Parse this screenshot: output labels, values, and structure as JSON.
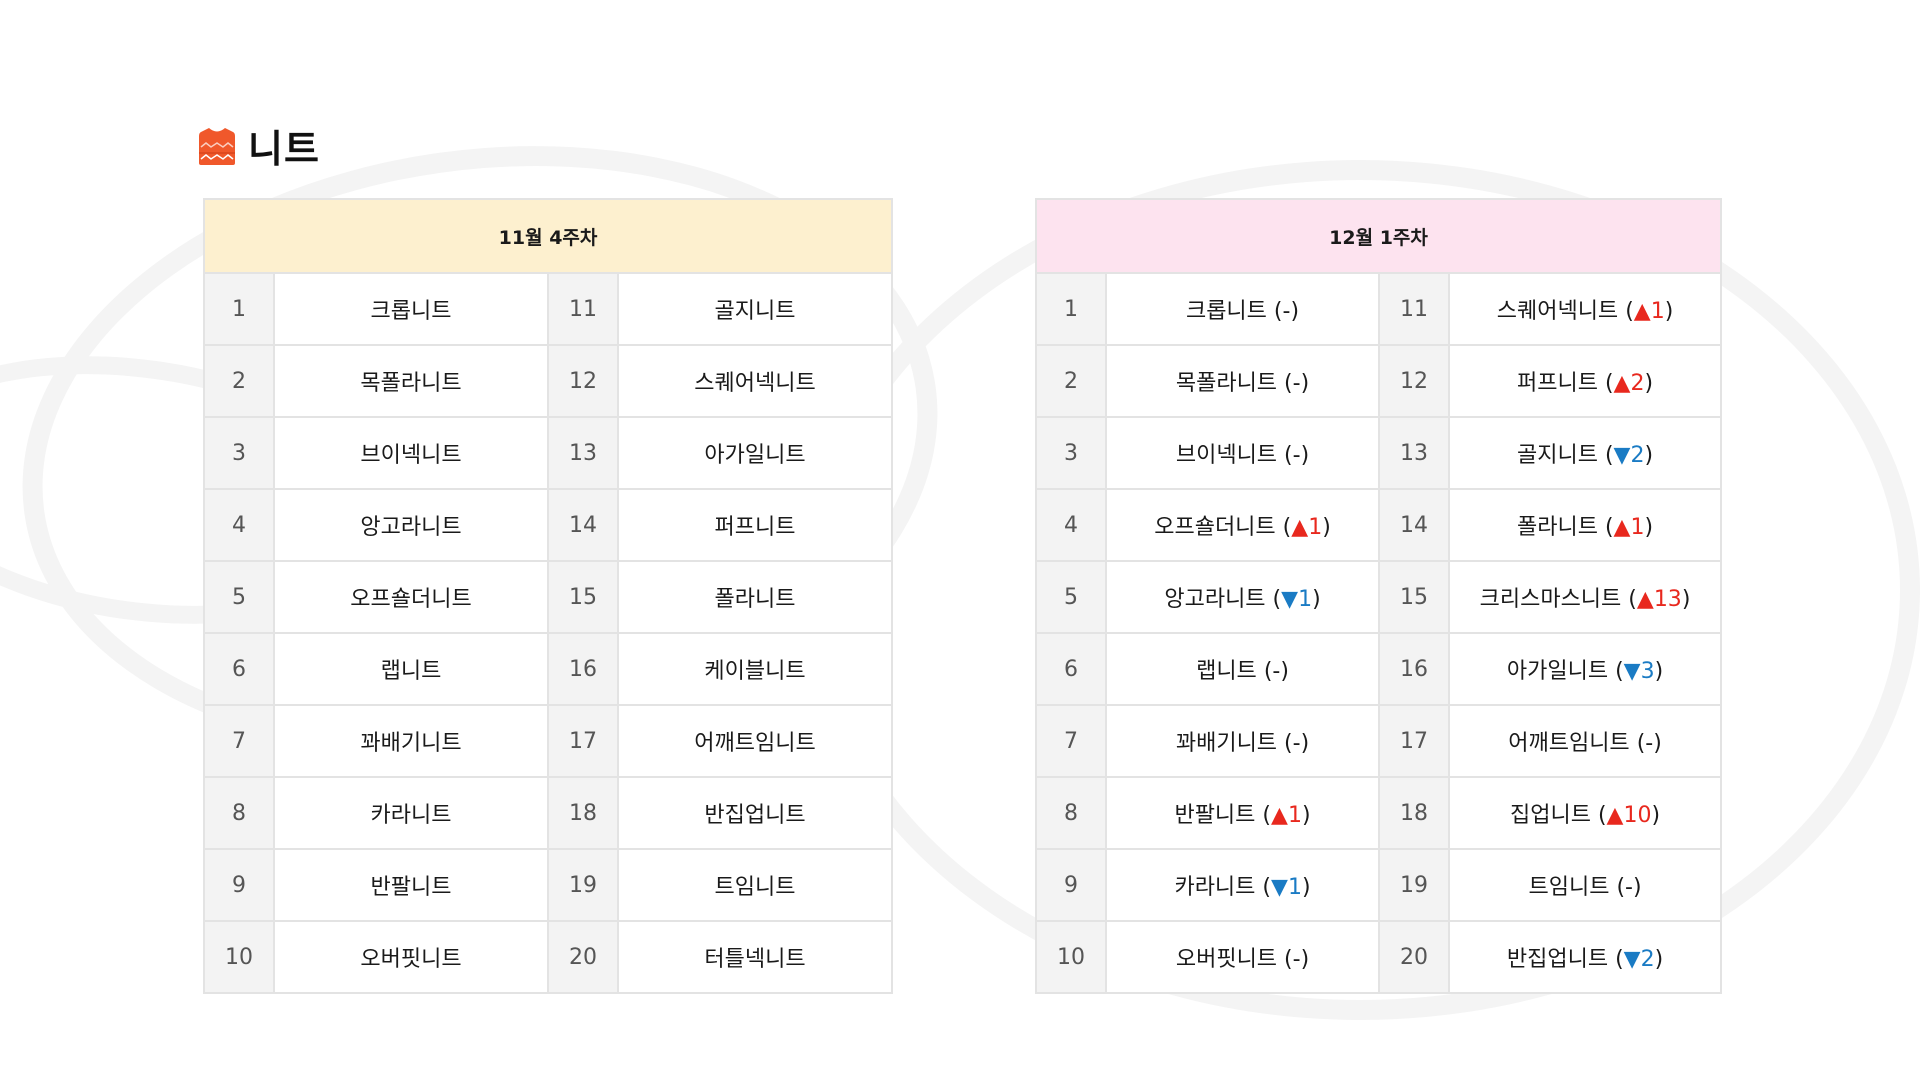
{
  "title": {
    "text": "니트",
    "icon": "sweater-icon",
    "icon_color": "#f0582b"
  },
  "colors": {
    "week1_header_bg": "#fdf0cf",
    "week2_header_bg": "#fde3ef",
    "up": "#e8281e",
    "down": "#1a7bc4"
  },
  "week1": {
    "header": "11월 4주차",
    "rows": [
      {
        "rank": "1",
        "name": "크롭니트",
        "rank2": "11",
        "name2": "골지니트"
      },
      {
        "rank": "2",
        "name": "목폴라니트",
        "rank2": "12",
        "name2": "스퀘어넥니트"
      },
      {
        "rank": "3",
        "name": "브이넥니트",
        "rank2": "13",
        "name2": "아가일니트"
      },
      {
        "rank": "4",
        "name": "앙고라니트",
        "rank2": "14",
        "name2": "퍼프니트"
      },
      {
        "rank": "5",
        "name": "오프숄더니트",
        "rank2": "15",
        "name2": "폴라니트"
      },
      {
        "rank": "6",
        "name": "랩니트",
        "rank2": "16",
        "name2": "케이블니트"
      },
      {
        "rank": "7",
        "name": "꽈배기니트",
        "rank2": "17",
        "name2": "어깨트임니트"
      },
      {
        "rank": "8",
        "name": "카라니트",
        "rank2": "18",
        "name2": "반집업니트"
      },
      {
        "rank": "9",
        "name": "반팔니트",
        "rank2": "19",
        "name2": "트임니트"
      },
      {
        "rank": "10",
        "name": "오버핏니트",
        "rank2": "20",
        "name2": "터틀넥니트"
      }
    ]
  },
  "week2": {
    "header": "12월 1주차",
    "rows": [
      {
        "rank": "1",
        "name": "크롭니트",
        "change": "(-)",
        "dir": "same",
        "rank2": "11",
        "name2": "스퀘어넥니트",
        "change2": "1",
        "dir2": "up"
      },
      {
        "rank": "2",
        "name": "목폴라니트",
        "change": "(-)",
        "dir": "same",
        "rank2": "12",
        "name2": "퍼프니트",
        "change2": "2",
        "dir2": "up"
      },
      {
        "rank": "3",
        "name": "브이넥니트",
        "change": "(-)",
        "dir": "same",
        "rank2": "13",
        "name2": "골지니트",
        "change2": "2",
        "dir2": "down"
      },
      {
        "rank": "4",
        "name": "오프숄더니트",
        "change": "1",
        "dir": "up",
        "rank2": "14",
        "name2": "폴라니트",
        "change2": "1",
        "dir2": "up"
      },
      {
        "rank": "5",
        "name": "앙고라니트",
        "change": "1",
        "dir": "down",
        "rank2": "15",
        "name2": "크리스마스니트",
        "change2": "13",
        "dir2": "up"
      },
      {
        "rank": "6",
        "name": "랩니트",
        "change": "(-)",
        "dir": "same",
        "rank2": "16",
        "name2": "아가일니트",
        "change2": "3",
        "dir2": "down"
      },
      {
        "rank": "7",
        "name": "꽈배기니트",
        "change": "(-)",
        "dir": "same",
        "rank2": "17",
        "name2": "어깨트임니트",
        "change2": "(-)",
        "dir2": "same"
      },
      {
        "rank": "8",
        "name": "반팔니트",
        "change": "1",
        "dir": "up",
        "rank2": "18",
        "name2": "집업니트",
        "change2": "10",
        "dir2": "up"
      },
      {
        "rank": "9",
        "name": "카라니트",
        "change": "1",
        "dir": "down",
        "rank2": "19",
        "name2": "트임니트",
        "change2": "(-)",
        "dir2": "same"
      },
      {
        "rank": "10",
        "name": "오버핏니트",
        "change": "(-)",
        "dir": "same",
        "rank2": "20",
        "name2": "반집업니트",
        "change2": "2",
        "dir2": "down"
      }
    ]
  }
}
